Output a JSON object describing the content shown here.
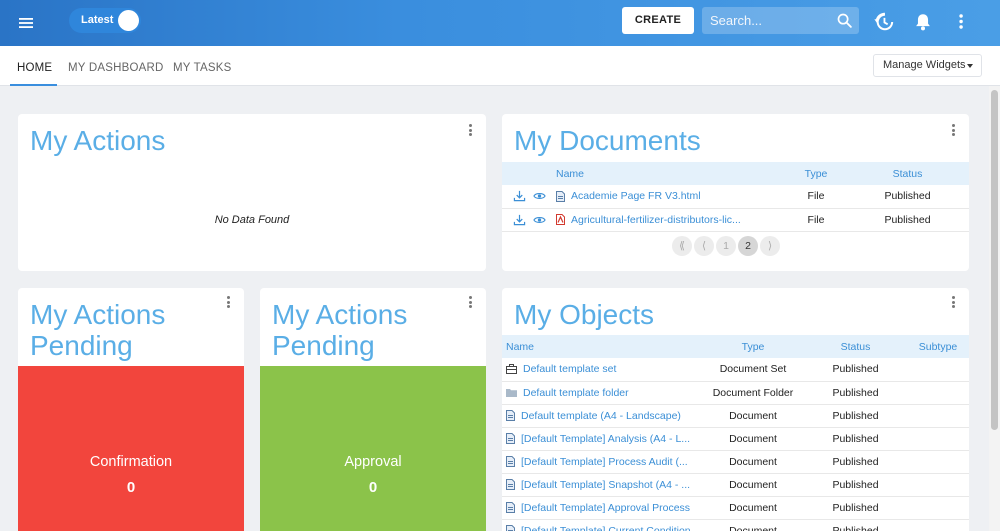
{
  "topbar": {
    "toggle_label": "Latest",
    "create_label": "CREATE",
    "search_placeholder": "Search..."
  },
  "tabs": [
    {
      "label": "HOME",
      "active": true
    },
    {
      "label": "MY DASHBOARD",
      "active": false
    },
    {
      "label": "MY TASKS",
      "active": false
    }
  ],
  "manage_widgets_label": "Manage Widgets",
  "my_actions": {
    "title": "My Actions",
    "empty_text": "No Data Found"
  },
  "my_documents": {
    "title": "My Documents",
    "columns": [
      "Name",
      "Type",
      "Status"
    ],
    "rows": [
      {
        "name": "Academie Page FR V3.html",
        "type": "File",
        "status": "Published",
        "icon": "html-file-icon"
      },
      {
        "name": "Agricultural-fertilizer-distributors-lic...",
        "type": "File",
        "status": "Published",
        "icon": "pdf-file-icon"
      }
    ],
    "pager": {
      "first": "⟪",
      "prev": "⟨",
      "pages": [
        "1",
        "2"
      ],
      "current": "2",
      "next": "⟩"
    }
  },
  "actions_pending_1": {
    "title_line1": "My Actions",
    "title_line2": "Pending",
    "tile_label": "Confirmation",
    "count": "0",
    "color": "#f2453d"
  },
  "actions_pending_2": {
    "title_line1": "My Actions",
    "title_line2": "Pending",
    "tile_label": "Approval",
    "count": "0",
    "color": "#8bc34a"
  },
  "my_objects": {
    "title": "My Objects",
    "columns": [
      "Name",
      "Type",
      "Status",
      "Subtype"
    ],
    "rows": [
      {
        "name": "Default template set",
        "type": "Document Set",
        "status": "Published",
        "subtype": "",
        "icon": "briefcase-icon"
      },
      {
        "name": "Default template folder",
        "type": "Document Folder",
        "status": "Published",
        "subtype": "",
        "icon": "folder-icon"
      },
      {
        "name": "Default template (A4 - Landscape)",
        "type": "Document",
        "status": "Published",
        "subtype": "",
        "icon": "document-icon"
      },
      {
        "name": "[Default Template] Analysis (A4 - L...",
        "type": "Document",
        "status": "Published",
        "subtype": "",
        "icon": "document-icon"
      },
      {
        "name": "[Default Template] Process Audit (...",
        "type": "Document",
        "status": "Published",
        "subtype": "",
        "icon": "document-icon"
      },
      {
        "name": "[Default Template] Snapshot (A4 - ...",
        "type": "Document",
        "status": "Published",
        "subtype": "",
        "icon": "document-icon"
      },
      {
        "name": "[Default Template] Approval Process",
        "type": "Document",
        "status": "Published",
        "subtype": "",
        "icon": "document-icon"
      },
      {
        "name": "[Default Template] Current Condition",
        "type": "Document",
        "status": "Published",
        "subtype": "",
        "icon": "document-icon"
      }
    ]
  },
  "colors": {
    "accent": "#3a8ede",
    "title_blue": "#5aaee6",
    "header_row": "#e4f1fb"
  }
}
